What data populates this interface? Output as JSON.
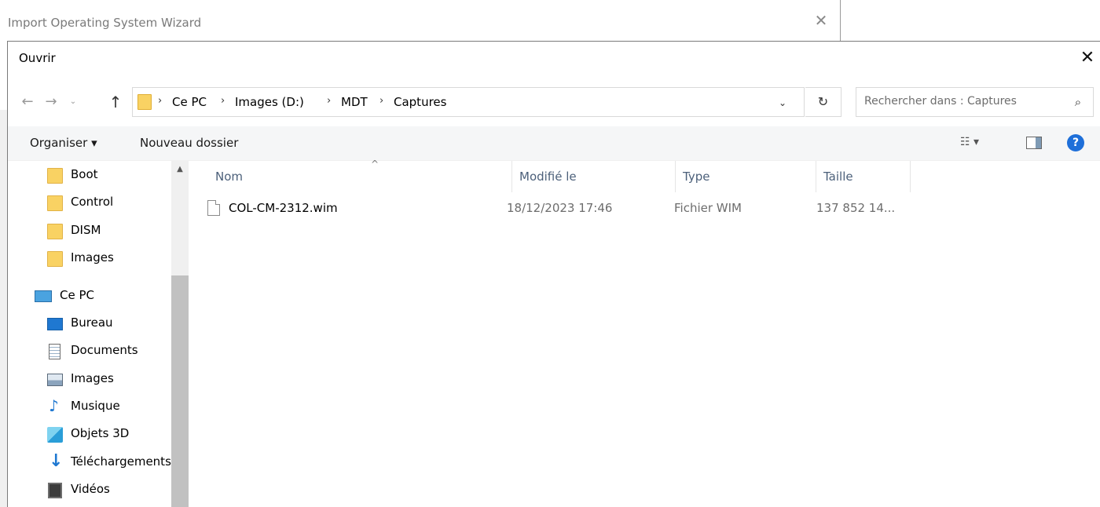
{
  "wizard": {
    "title": "Import Operating System Wizard",
    "close_glyph": "✕"
  },
  "dialog": {
    "title": "Ouvrir",
    "close_glyph": "✕"
  },
  "navigation": {
    "back_glyph": "←",
    "forward_glyph": "→",
    "recent_glyph": "⌄",
    "up_glyph": "↑",
    "breadcrumb": [
      "Ce PC",
      "Images (D:)",
      "MDT",
      "Captures"
    ],
    "separator": "›",
    "dropdown_glyph": "⌄",
    "refresh_glyph": "↻"
  },
  "search": {
    "placeholder": "Rechercher dans : Captures",
    "icon": "search-icon",
    "glyph": "⌕"
  },
  "toolbar": {
    "organize_label": "Organiser ▾",
    "new_folder_label": "Nouveau dossier",
    "view_glyph": "☷ ▾",
    "help_glyph": "?"
  },
  "nav_pane": {
    "items": [
      {
        "label": "Boot",
        "icon": "folder-icon"
      },
      {
        "label": "Control",
        "icon": "folder-icon"
      },
      {
        "label": "DISM",
        "icon": "folder-icon"
      },
      {
        "label": "Images",
        "icon": "folder-icon"
      },
      {
        "label": "Ce PC",
        "icon": "computer-icon"
      },
      {
        "label": "Bureau",
        "icon": "desktop-icon"
      },
      {
        "label": "Documents",
        "icon": "documents-icon"
      },
      {
        "label": "Images",
        "icon": "pictures-icon"
      },
      {
        "label": "Musique",
        "icon": "music-icon"
      },
      {
        "label": "Objets 3D",
        "icon": "3d-objects-icon"
      },
      {
        "label": "Téléchargements",
        "icon": "downloads-icon"
      },
      {
        "label": "Vidéos",
        "icon": "videos-icon"
      }
    ],
    "scroll_up_glyph": "▲"
  },
  "file_list": {
    "columns": [
      "Nom",
      "Modifié le",
      "Type",
      "Taille"
    ],
    "sort_glyph": "^",
    "rows": [
      {
        "name": "COL-CM-2312.wim",
        "modified": "18/12/2023 17:46",
        "type": "Fichier WIM",
        "size": "137 852 14..."
      }
    ]
  }
}
